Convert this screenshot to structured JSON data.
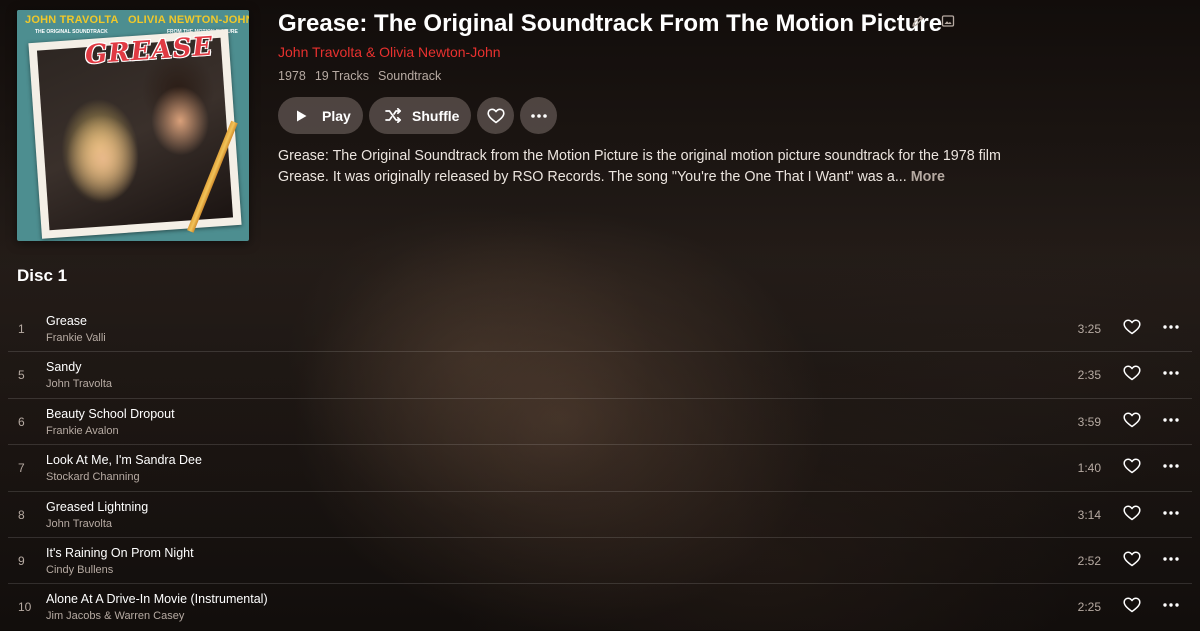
{
  "album": {
    "title": "Grease: The Original Soundtrack From The Motion Picture",
    "artist": "John Travolta & Olivia Newton-John",
    "year": "1978",
    "track_count": "19 Tracks",
    "genre": "Soundtrack",
    "description": "Grease: The Original Soundtrack from the Motion Picture is the original motion picture soundtrack for the 1978 film Grease. It was originally released by RSO Records. The song \"You're the One That I Want\" was a...",
    "more_label": "More"
  },
  "cover": {
    "artist_left": "JOHN TRAVOLTA",
    "artist_right": "OLIVIA NEWTON-JOHN",
    "subtitle_left": "THE ORIGINAL SOUNDTRACK",
    "subtitle_right": "FROM THE MOTION PICTURE",
    "logo": "GREASE"
  },
  "actions": {
    "play_label": "Play",
    "shuffle_label": "Shuffle"
  },
  "disc": {
    "label": "Disc 1"
  },
  "tracks": [
    {
      "number": "1",
      "title": "Grease",
      "artist": "Frankie Valli",
      "duration": "3:25"
    },
    {
      "number": "5",
      "title": "Sandy",
      "artist": "John Travolta",
      "duration": "2:35"
    },
    {
      "number": "6",
      "title": "Beauty School Dropout",
      "artist": "Frankie Avalon",
      "duration": "3:59"
    },
    {
      "number": "7",
      "title": "Look At Me, I'm Sandra Dee",
      "artist": "Stockard Channing",
      "duration": "1:40"
    },
    {
      "number": "8",
      "title": "Greased Lightning",
      "artist": "John Travolta",
      "duration": "3:14"
    },
    {
      "number": "9",
      "title": "It's Raining On Prom Night",
      "artist": "Cindy Bullens",
      "duration": "2:52"
    },
    {
      "number": "10",
      "title": "Alone At A Drive-In Movie (Instrumental)",
      "artist": "Jim Jacobs & Warren Casey",
      "duration": "2:25"
    }
  ],
  "icons": {
    "edit": "pencil-icon",
    "artwork": "image-icon",
    "play": "play-icon",
    "shuffle": "shuffle-icon",
    "favorite": "heart-icon",
    "more": "more-horizontal-icon"
  },
  "colors": {
    "accent": "#e8312f",
    "secondary_text": "#b6aaa2",
    "button_bg": "#605652"
  }
}
